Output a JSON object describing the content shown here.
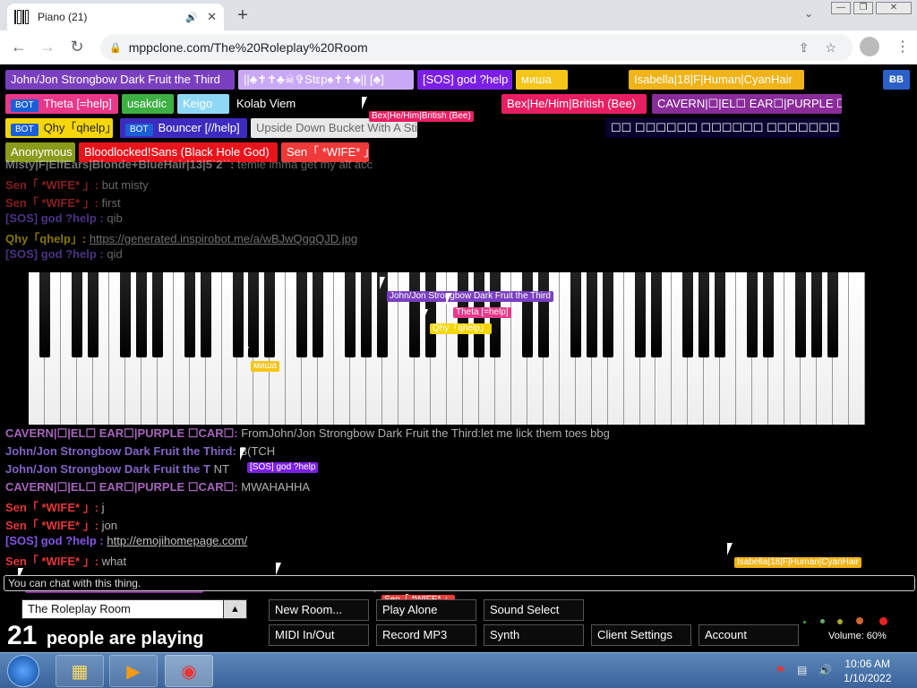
{
  "browser": {
    "tab_title": "Piano (21)",
    "url": "mppclone.com/The%20Roleplay%20Room"
  },
  "header_tags": [
    {
      "label": "John/Jon Strongbow Dark Fruit the Third",
      "bg": "#7a3fbf",
      "fg": "#ffffff",
      "bot": false
    },
    {
      "label": "||♣✝✝♣☠✞Stεp♠✝✝♣|| [♣]",
      "bg": "#c9a9f5",
      "fg": "#ffffff",
      "bot": false
    },
    {
      "label": "[SOS] god ?help",
      "bg": "#7b1fe6",
      "fg": "#ffffff",
      "bot": false
    },
    {
      "label": "миша",
      "bg": "#f5c518",
      "fg": "#ffffff",
      "bot": false
    },
    {
      "label": "Isabella|18|F|Human|CyanHair",
      "bg": "#f0b318",
      "fg": "#ffffff",
      "bot": false
    },
    {
      "label": "Theta [=help]",
      "bg": "#e8388a",
      "fg": "#ffffff",
      "bot": true
    },
    {
      "label": "usakdic",
      "bg": "#3cb043",
      "fg": "#ffffff",
      "bot": false
    },
    {
      "label": "Keigo",
      "bg": "#8fd8f5",
      "fg": "#ffffff",
      "bot": false
    },
    {
      "label": "Kolab Viem",
      "bg": "#000000",
      "fg": "#ffffff",
      "bot": false
    },
    {
      "label": "Bex|He/Him|British (Bee)",
      "bg": "#e81e63",
      "fg": "#ffffff",
      "bot": false
    },
    {
      "label": "CAVERN|☐|EL☐ EAR☐|PURPLE ☐CAR☐",
      "bg": "#8a2c9a",
      "fg": "#ffffff",
      "bot": false
    },
    {
      "label": "Qhy「qhelp」",
      "bg": "#f5d60a",
      "fg": "#222222",
      "bot": true
    },
    {
      "label": "Bouncer [//help]",
      "bg": "#3d2bbf",
      "fg": "#ffffff",
      "bot": true
    },
    {
      "label": "Upside Down Bucket With A Stick",
      "bg": "#e8e8e8",
      "fg": "#666666",
      "bot": false
    },
    {
      "label": "☐☐ ☐☐☐☐☐☐ ☐☐☐☐☐☐ ☐☐☐☐☐☐☐ ☐☐",
      "bg": "#0a0030",
      "fg": "#ffffff",
      "bot": false
    },
    {
      "label": "Anonymous",
      "bg": "#8a9a1a",
      "fg": "#ffffff",
      "bot": false
    },
    {
      "label": "Bloodlocked!Sans (Black Hole God)",
      "bg": "#e8141c",
      "fg": "#ffffff",
      "bot": false
    },
    {
      "label": "Sen「 *WIFE* 」",
      "bg": "#f03a3a",
      "fg": "#ffffff",
      "bot": false
    }
  ],
  "bb_button": "ɃB",
  "faded_chat": [
    {
      "name": "Misty|F|ElfEars|Blonde+BlueHair|13|5`2``:",
      "color": "#cccccc",
      "text": "temie imma get my alt acc",
      "link": false
    },
    {
      "name": "Sen「 *WIFE* 」:",
      "color": "#f03a3a",
      "text": "but misty",
      "link": false
    },
    {
      "name": "Sen「 *WIFE* 」:",
      "color": "#f03a3a",
      "text": "first",
      "link": false
    },
    {
      "name": "[SOS] god ?help :",
      "color": "#8a5cf0",
      "text": "qib",
      "link": false
    },
    {
      "name": "Qhy「qhelp」:",
      "color": "#f5d60a",
      "text": "https://generated.inspirobot.me/a/wBJwQgqQJD.jpg",
      "link": true
    },
    {
      "name": "[SOS] god ?help :",
      "color": "#8a5cf0",
      "text": "qid",
      "link": false
    }
  ],
  "bright_chat": [
    {
      "name": "CAVERN|☐|EL☐ EAR☐|PURPLE ☐CAR☐:",
      "color": "#b06ac8",
      "text": "FromJohn/Jon Strongbow Dark Fruit the Third:let me lick them toes bbg",
      "link": false
    },
    {
      "name": "John/Jon Strongbow Dark Fruit the Third:",
      "color": "#8a6ad0",
      "text": "B(TCH",
      "link": false
    },
    {
      "name": "John/Jon Strongbow Dark Fruit the T",
      "color": "#8a6ad0",
      "text": "NT",
      "link": false
    },
    {
      "name": "CAVERN|☐|EL☐ EAR☐|PURPLE ☐CAR☐:",
      "color": "#b06ac8",
      "text": "MWAHAHHA",
      "link": false
    },
    {
      "name": "Sen「 *WIFE* 」:",
      "color": "#f03a3a",
      "text": "j",
      "link": false
    },
    {
      "name": "Sen「 *WIFE* 」:",
      "color": "#f03a3a",
      "text": "jon",
      "link": false
    },
    {
      "name": "[SOS] god ?help :",
      "color": "#8a5cf0",
      "text": "http://emojihomepage.com/",
      "link": true
    },
    {
      "name": "Sen「 *WIFE* 」:",
      "color": "#f03a3a",
      "text": "what",
      "link": false
    }
  ],
  "cursors": [
    {
      "label": "John/Jon Strongbow Dark Fruit the Third",
      "bg": "#7a3fbf"
    },
    {
      "label": "Theta [=help]",
      "bg": "#e8388a"
    },
    {
      "label": "Qhy「qhelp」",
      "bg": "#f5d60a"
    },
    {
      "label": "миша",
      "bg": "#f5c518"
    },
    {
      "label": "[SOS] god ?help",
      "bg": "#7b1fe6"
    },
    {
      "label": "Isabella|18|F|Human|CyanHair",
      "bg": "#f0b318"
    },
    {
      "label": "CAVERN|☐|EL☐ EAR☐|PURPLE ☐CAR☐",
      "bg": "#8a2c9a"
    },
    {
      "label": "usakdic",
      "bg": "#3cb043"
    },
    {
      "label": "Sen「 *WIFE* 」",
      "bg": "#f03a3a"
    },
    {
      "label": "Bex|He/Him|British (Bee)",
      "bg": "#e81e63"
    }
  ],
  "chat_input_placeholder": "You can chat with this thing.",
  "room": {
    "name": "The Roleplay Room"
  },
  "player_count": {
    "number": "21",
    "text": "people are playing"
  },
  "buttons": {
    "new_room": "New Room...",
    "play_alone": "Play Alone",
    "sound_select": "Sound Select",
    "midi": "MIDI In/Out",
    "record": "Record MP3",
    "synth": "Synth",
    "client_settings": "Client Settings",
    "account": "Account"
  },
  "volume": "Volume: 60%",
  "taskbar": {
    "time": "10:06 AM",
    "date": "1/10/2022"
  }
}
